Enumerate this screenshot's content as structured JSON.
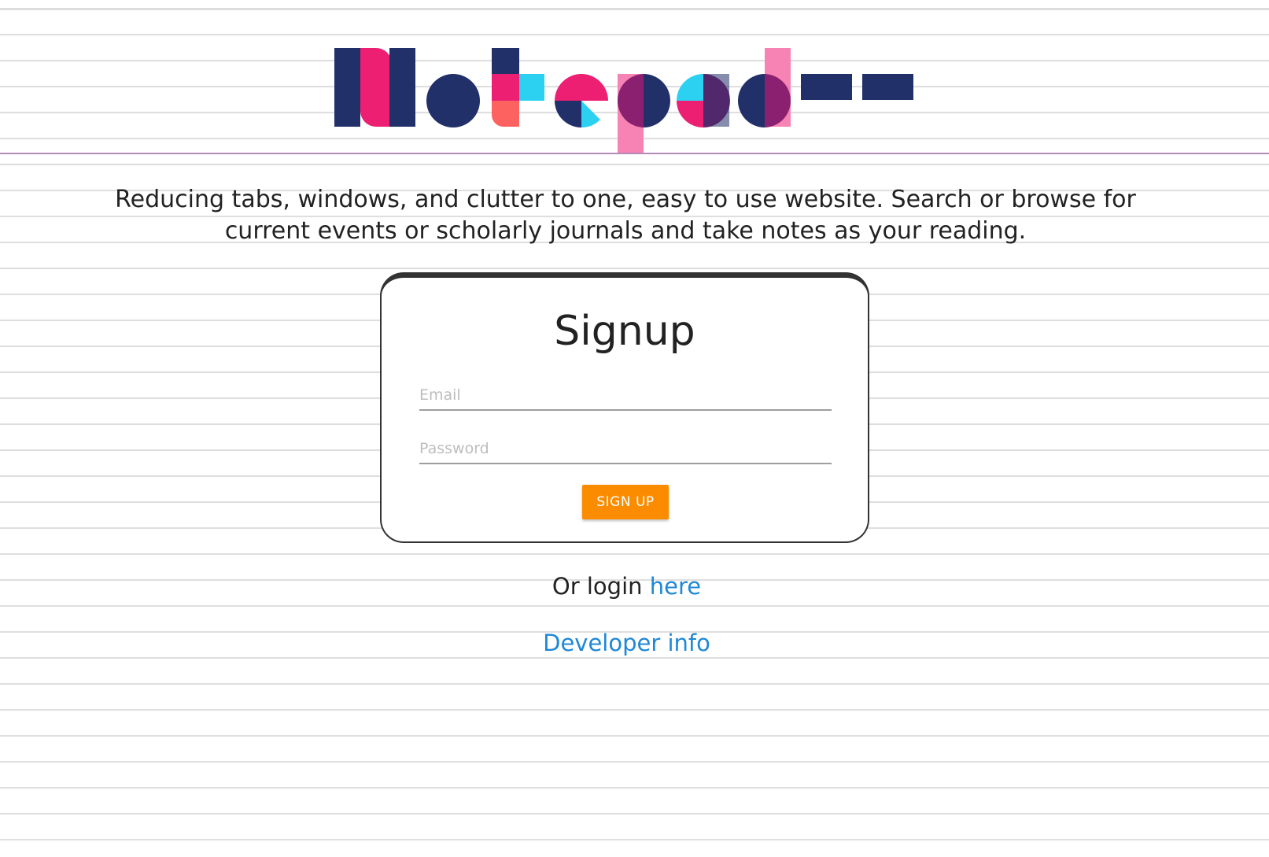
{
  "header": {
    "logo_text": "Notepad--",
    "colors": {
      "navy": "#22306a",
      "pink": "#ec1f73",
      "cyan": "#2cd1f1",
      "coral": "#fe6260",
      "purple": "#8b2070",
      "light_pink": "#f683b3",
      "margin_line": "#b48ab8"
    }
  },
  "tagline": "Reducing tabs, windows, and clutter to one, easy to use website. Search or browse for current events or scholarly journals and take notes as your reading.",
  "signup": {
    "title": "Signup",
    "email_placeholder": "Email",
    "email_value": "",
    "password_placeholder": "Password",
    "password_value": "",
    "button_label": "SIGN UP",
    "button_color": "#fb8c00"
  },
  "login": {
    "prefix": "Or login ",
    "link_text": "here"
  },
  "developer": {
    "link_text": "Developer info"
  }
}
